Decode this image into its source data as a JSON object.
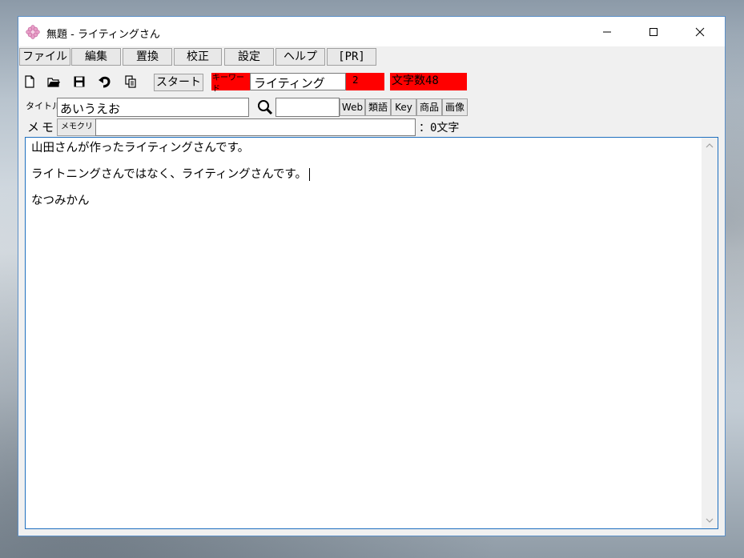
{
  "window": {
    "title": "無題 - ライティングさん",
    "minimize_glyph": "—",
    "maximize_glyph": "☐",
    "close_glyph": "✕"
  },
  "menu": [
    {
      "label": "ファイル"
    },
    {
      "label": "編集"
    },
    {
      "label": "置換"
    },
    {
      "label": "校正"
    },
    {
      "label": "設定"
    },
    {
      "label": "ヘルプ"
    },
    {
      "label": "[PR]"
    }
  ],
  "toolbar": {
    "icons": [
      "new-file-icon",
      "open-folder-icon",
      "save-icon",
      "undo-icon",
      "copy-icon"
    ],
    "start_label": "スタート",
    "keyword_label": "キーワード",
    "keyword_value": "ライティング",
    "keyword_count": "2",
    "char_count": "文字数48"
  },
  "title_row": {
    "label": "タイトル",
    "value": "あいうえお",
    "search_value": "",
    "buttons": [
      "Web",
      "類語",
      "Key",
      "商品",
      "画像"
    ]
  },
  "memo_row": {
    "label": "メモ",
    "clear_label": "メモクリア",
    "value": "",
    "count": "：0文字"
  },
  "editor": {
    "lines": [
      "山田さんが作ったライティングさんです。",
      "ライトニングさんではなく、ライティングさんです。",
      "なつみかん"
    ]
  },
  "colors": {
    "highlight_red": "#ff0000",
    "accent_border": "#1e6fbf",
    "window_border": "#5b8fc7"
  }
}
